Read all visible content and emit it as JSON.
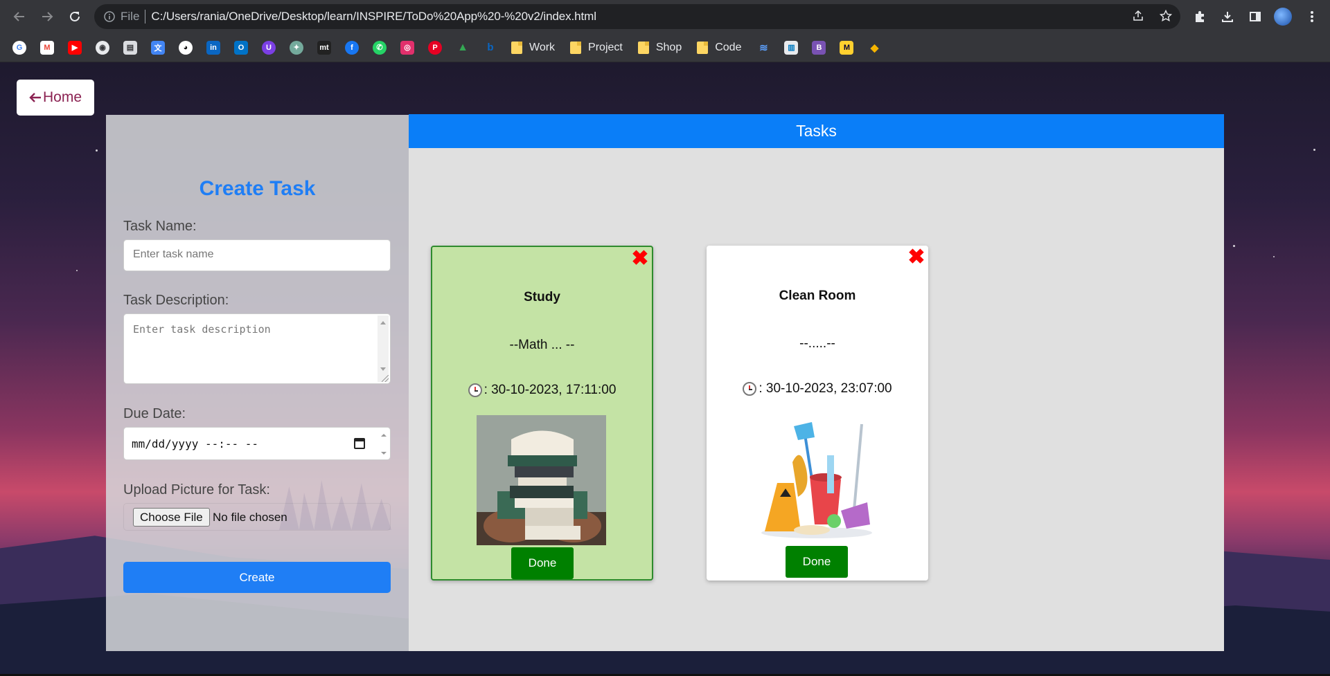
{
  "browser": {
    "file_label": "File",
    "url": "C:/Users/rania/OneDrive/Desktop/learn/INSPIRE/ToDo%20App%20-%20v2/index.html",
    "bookmark_folders": [
      "Work",
      "Project",
      "Shop",
      "Code"
    ]
  },
  "home": {
    "label": "Home",
    "icon": "arrow-left-icon"
  },
  "form": {
    "title": "Create Task",
    "task_name_label": "Task Name:",
    "task_name_placeholder": "Enter task name",
    "task_desc_label": "Task Description:",
    "task_desc_placeholder": "Enter task description",
    "due_date_label": "Due Date:",
    "due_date_placeholder": "mm/dd/yyyy --:-- --",
    "upload_label": "Upload Picture for Task:",
    "choose_file": "Choose File",
    "no_file": "No file chosen",
    "create_label": "Create"
  },
  "tasks": {
    "header": "Tasks",
    "items": [
      {
        "title": "Study",
        "description": "--Math ... --",
        "date": ": 30-10-2023, 17:11:00",
        "done_label": "Done",
        "completed": true,
        "bg": "#c4e3a5"
      },
      {
        "title": "Clean Room",
        "description": "--.....--",
        "date": ": 30-10-2023, 23:07:00",
        "done_label": "Done",
        "completed": false,
        "bg": "#ffffff"
      }
    ]
  },
  "colors": {
    "accent": "#1f7ef5",
    "tasks_header": "#0a7ef8",
    "done": "#008000",
    "close": "#ff0000",
    "home_text": "#8b2252"
  }
}
